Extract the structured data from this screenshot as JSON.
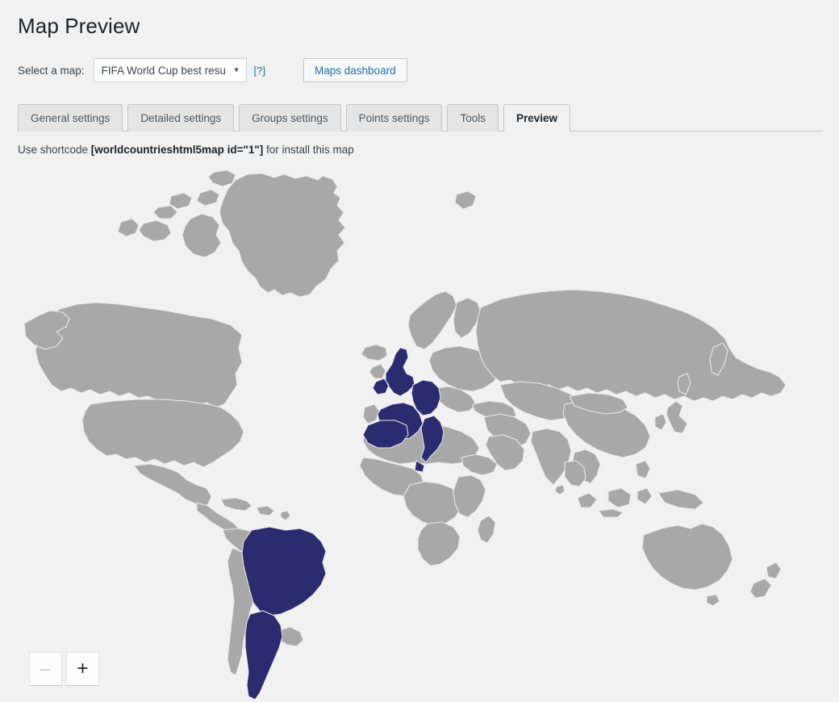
{
  "header": {
    "title": "Map Preview",
    "select_label": "Select a map:",
    "selected_map": "FIFA World Cup best resu",
    "select_caret": "▼",
    "help_link": "[?]",
    "dashboard_button": "Maps dashboard"
  },
  "tabs": [
    {
      "label": "General settings",
      "active": false
    },
    {
      "label": "Detailed settings",
      "active": false
    },
    {
      "label": "Groups settings",
      "active": false
    },
    {
      "label": "Points settings",
      "active": false
    },
    {
      "label": "Tools",
      "active": false
    },
    {
      "label": "Preview",
      "active": true
    }
  ],
  "shortcode": {
    "prefix": "Use shortcode ",
    "code": "[worldcountrieshtml5map id=\"1\"]",
    "suffix": " for install this map"
  },
  "map": {
    "land_color": "#a8a8a8",
    "highlight_color": "#2b2b70",
    "border_color": "#e9e9e9",
    "background_color": "#f1f1f1",
    "highlighted_countries": [
      "United Kingdom",
      "France",
      "Germany",
      "Italy",
      "Spain",
      "Brazil",
      "Argentina"
    ]
  },
  "zoom_controls": {
    "zoom_out_label": "–",
    "zoom_in_label": "+"
  }
}
